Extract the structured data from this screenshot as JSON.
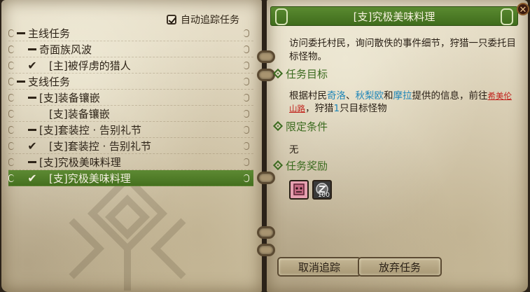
{
  "left_panel": {
    "auto_track": {
      "label": "自动追踪任务",
      "checked": true
    },
    "quests": [
      {
        "kind": "header",
        "label": "主线任务"
      },
      {
        "kind": "group",
        "label": "奇面族风波"
      },
      {
        "kind": "item",
        "checked": true,
        "label": "[主]被俘虏的猎人"
      },
      {
        "kind": "header",
        "label": "支线任务"
      },
      {
        "kind": "group",
        "label": "[支]装备镶嵌"
      },
      {
        "kind": "item",
        "checked": false,
        "label": "[支]装备镶嵌"
      },
      {
        "kind": "group",
        "label": "[支]套装控 · 告别礼节"
      },
      {
        "kind": "item",
        "checked": true,
        "label": "[支]套装控 · 告别礼节"
      },
      {
        "kind": "group",
        "label": "[支]究极美味料理"
      },
      {
        "kind": "item",
        "checked": true,
        "selected": true,
        "label": "[支]究极美味料理"
      }
    ]
  },
  "right_panel": {
    "title": "[支]究极美味料理",
    "close_icon": "x-icon",
    "description": "访问委托村民，询问散佚的事件细节，狩猎一只委托目标怪物。",
    "objective_heading": "任务目标",
    "objective": {
      "p1": "根据村民",
      "npc1": "奇洛",
      "sep1": "、",
      "npc2": "秋梨欧",
      "p2": "和",
      "npc3": "摩拉",
      "p3": "提供的信息，前往",
      "location": "希美伦山路",
      "p4": "，狩猎",
      "count": "1",
      "p5": "只目标怪物"
    },
    "conditions_heading": "限定条件",
    "conditions": "无",
    "rewards_heading": "任务奖励",
    "rewards": [
      {
        "icon": "monster-material-icon",
        "color": "#e6a0b0",
        "quantity": ""
      },
      {
        "icon": "zenny-coin-icon",
        "color": "#3a3a3a",
        "quantity": "100"
      }
    ],
    "buttons": {
      "cancel_track": "取消追踪",
      "abandon": "放弃任务"
    }
  },
  "colors": {
    "accent_green": "#4a7a25",
    "npc_blue": "#1f86b8",
    "location_red": "#c0211b",
    "parchment": "#e0d6bd"
  }
}
